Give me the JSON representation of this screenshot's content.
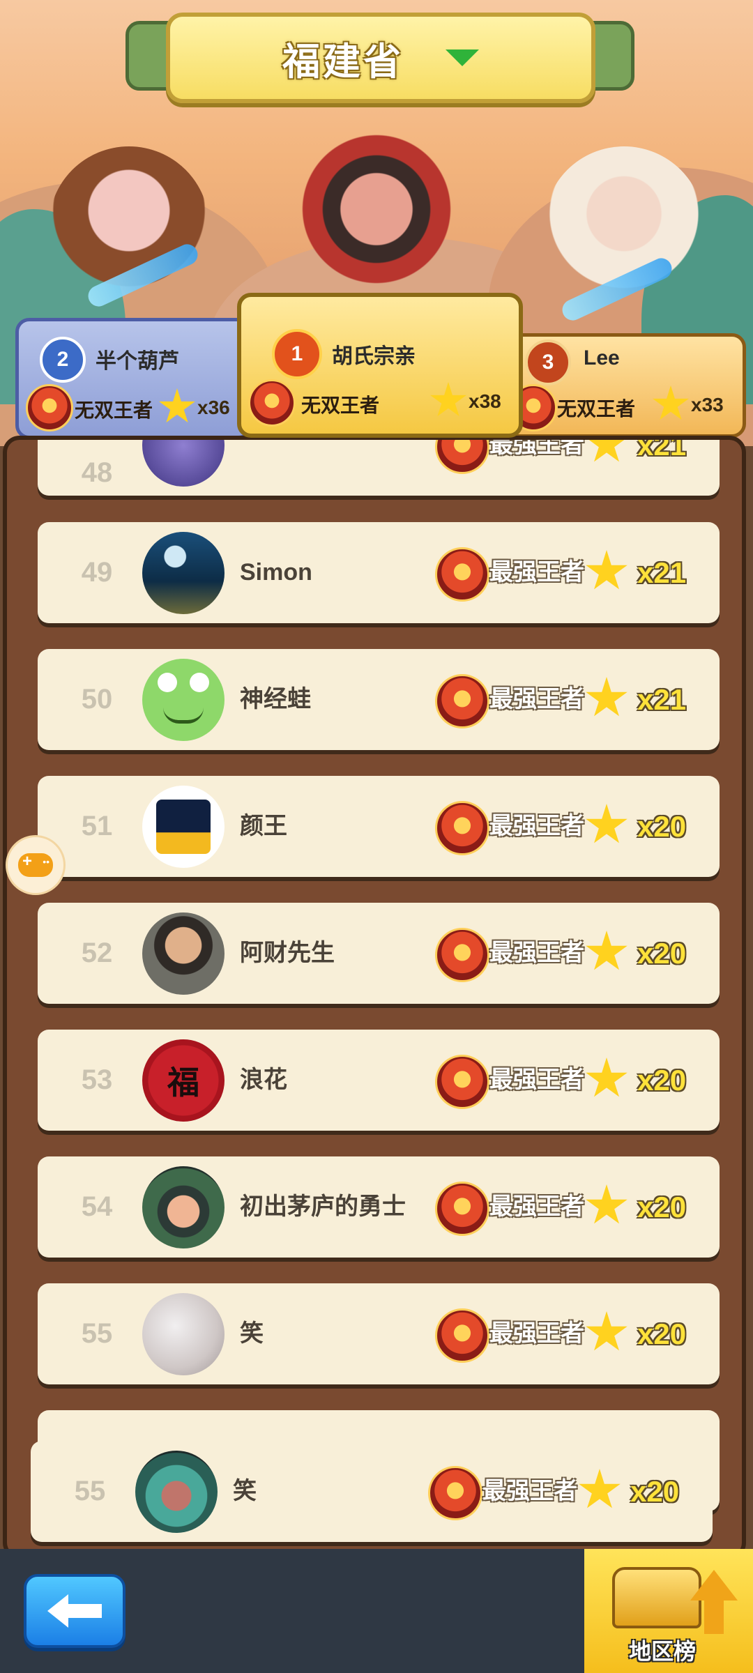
{
  "header": {
    "province": "福建省"
  },
  "podium": [
    {
      "rank": "2",
      "name": "半个葫芦",
      "title": "无双王者",
      "count": "x36"
    },
    {
      "rank": "1",
      "name": "胡氏宗亲",
      "title": "无双王者",
      "count": "x38"
    },
    {
      "rank": "3",
      "name": "Lee",
      "title": "无双王者",
      "count": "x33"
    }
  ],
  "list": [
    {
      "rank": "48",
      "name": "",
      "title": "最强王者",
      "count": "x21"
    },
    {
      "rank": "49",
      "name": "Simon",
      "title": "最强王者",
      "count": "x21"
    },
    {
      "rank": "50",
      "name": "神经蛙",
      "title": "最强王者",
      "count": "x21"
    },
    {
      "rank": "51",
      "name": "颜王",
      "title": "最强王者",
      "count": "x20"
    },
    {
      "rank": "52",
      "name": "阿财先生",
      "title": "最强王者",
      "count": "x20"
    },
    {
      "rank": "53",
      "name": "浪花",
      "title": "最强王者",
      "count": "x20"
    },
    {
      "rank": "54",
      "name": "初出茅庐的勇士",
      "title": "最强王者",
      "count": "x20"
    },
    {
      "rank": "55",
      "name": "笑",
      "title": "最强王者",
      "count": "x20"
    }
  ],
  "my_entry": {
    "rank": "55",
    "name": "笑",
    "title": "最强王者",
    "count": "x20"
  },
  "avatar_fu_text": "福",
  "bottom": {
    "region_label": "地区榜"
  },
  "colors": {
    "accent_yellow": "#ffe23a",
    "panel_brown": "#7a4a30",
    "back_blue": "#1b7fe6"
  }
}
